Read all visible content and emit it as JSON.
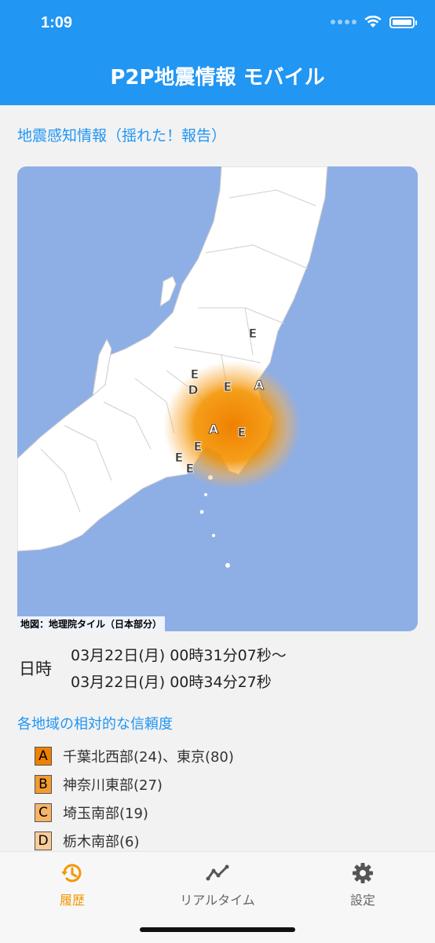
{
  "status_bar": {
    "time": "1:09"
  },
  "app": {
    "title": "P2P地震情報 モバイル"
  },
  "report": {
    "title": "地震感知情報（揺れた！報告）",
    "map_credit": "地図：地理院タイル（日本部分）",
    "datetime_label": "日時",
    "datetime_start": "03月22日(月) 00時31分07秒〜",
    "datetime_end": "03月22日(月) 00時34分27秒",
    "reliability_title": "各地域の相対的な信頼度",
    "reliability": [
      {
        "grade": "A",
        "text": "千葉北西部(24)、東京(80)",
        "color": "#f08000"
      },
      {
        "grade": "B",
        "text": "神奈川東部(27)",
        "color": "#f39a30"
      },
      {
        "grade": "C",
        "text": "埼玉南部(19)",
        "color": "#f6b466"
      },
      {
        "grade": "D",
        "text": "栃木南部(6)",
        "color": "#f9cd99"
      }
    ],
    "map_markers": [
      {
        "grade": "E"
      },
      {
        "grade": "E"
      },
      {
        "grade": "D"
      },
      {
        "grade": "E"
      },
      {
        "grade": "A"
      },
      {
        "grade": "A"
      },
      {
        "grade": "E"
      },
      {
        "grade": "E"
      },
      {
        "grade": "E"
      },
      {
        "grade": "E"
      }
    ]
  },
  "tabs": [
    {
      "label": "履歴",
      "icon": "history-icon",
      "active": true
    },
    {
      "label": "リアルタイム",
      "icon": "chart-line-icon",
      "active": false
    },
    {
      "label": "設定",
      "icon": "gear-icon",
      "active": false
    }
  ],
  "colors": {
    "primary": "#2196f3",
    "accent": "#f39800",
    "sea": "#8eaee6"
  }
}
